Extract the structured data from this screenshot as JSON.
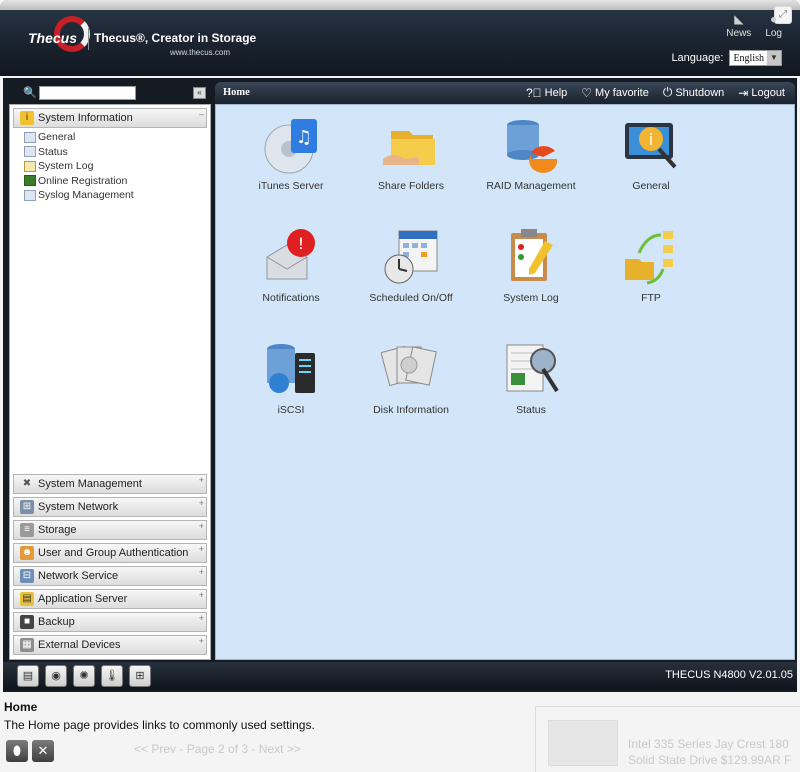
{
  "header": {
    "logo": "Thecus",
    "slogan": "Thecus®, Creator in Storage",
    "website": "www.thecus.com",
    "links": [
      {
        "label": "News",
        "icon": "rss-icon"
      },
      {
        "label": "Log",
        "icon": "chat-icon"
      }
    ],
    "language_label": "Language:",
    "language_value": "English"
  },
  "search": {
    "value": ""
  },
  "sidebar": {
    "groups": [
      {
        "label": "System Information",
        "items": [
          "General",
          "Status",
          "System Log",
          "Online Registration",
          "Syslog Management"
        ]
      },
      {
        "label": "System Management"
      },
      {
        "label": "System Network"
      },
      {
        "label": "Storage"
      },
      {
        "label": "User and Group Authentication"
      },
      {
        "label": "Network Service"
      },
      {
        "label": "Application Server"
      },
      {
        "label": "Backup"
      },
      {
        "label": "External Devices"
      }
    ]
  },
  "content": {
    "title": "Home",
    "actions": {
      "help": "Help",
      "favorite": "My favorite",
      "shutdown": "Shutdown",
      "logout": "Logout"
    },
    "tiles": [
      {
        "label": "iTunes Server"
      },
      {
        "label": "Share Folders"
      },
      {
        "label": "RAID Management"
      },
      {
        "label": "General"
      },
      {
        "label": "Notifications"
      },
      {
        "label": "Scheduled On/Off"
      },
      {
        "label": "System Log"
      },
      {
        "label": "FTP"
      },
      {
        "label": "iSCSI"
      },
      {
        "label": "Disk Information"
      },
      {
        "label": "Status"
      }
    ]
  },
  "footer": {
    "version": "THECUS N4800 V2.01.05"
  },
  "info": {
    "title": "Home",
    "text": "The Home page provides links to commonly used settings."
  },
  "backdrop": {
    "pager": "<< Prev - Page 2 of 3 - Next >>",
    "product_line1": "Intel 335 Series Jay Crest 180",
    "product_line2": "Solid State Drive $129.99AR F"
  }
}
